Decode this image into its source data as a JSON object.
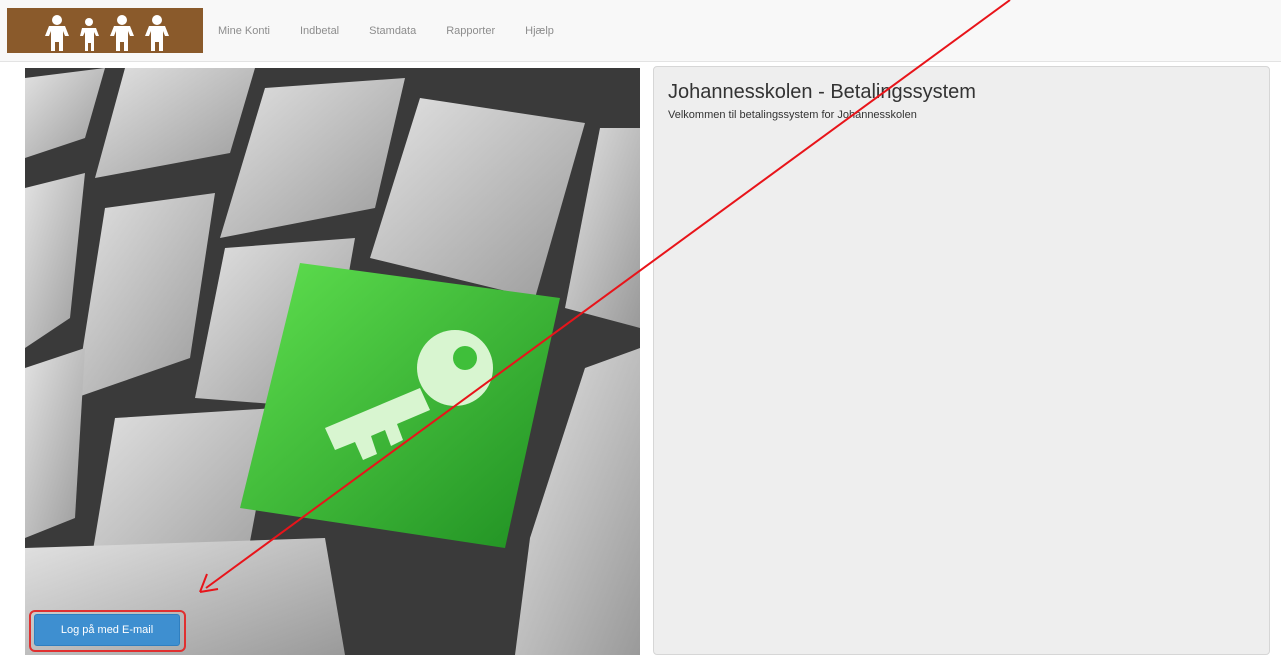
{
  "navbar": {
    "logo_icon": "family-logo-icon",
    "logo_color": "#8a5a2b",
    "links": [
      "Mine Konti",
      "Indbetal",
      "Stamdata",
      "Rapporter",
      "Hjælp"
    ]
  },
  "hero_image": {
    "icon": "keyboard-key-icon",
    "accent": "#3fbf3a"
  },
  "login": {
    "button_label": "Log på med E-mail",
    "button_color": "#3e8fd0"
  },
  "content": {
    "title": "Johannesskolen - Betalingssystem",
    "subtitle": "Velkommen til betalingssystem for Johannesskolen"
  },
  "annotation": {
    "icon": "arrow-annotation",
    "color": "#e8141a"
  }
}
